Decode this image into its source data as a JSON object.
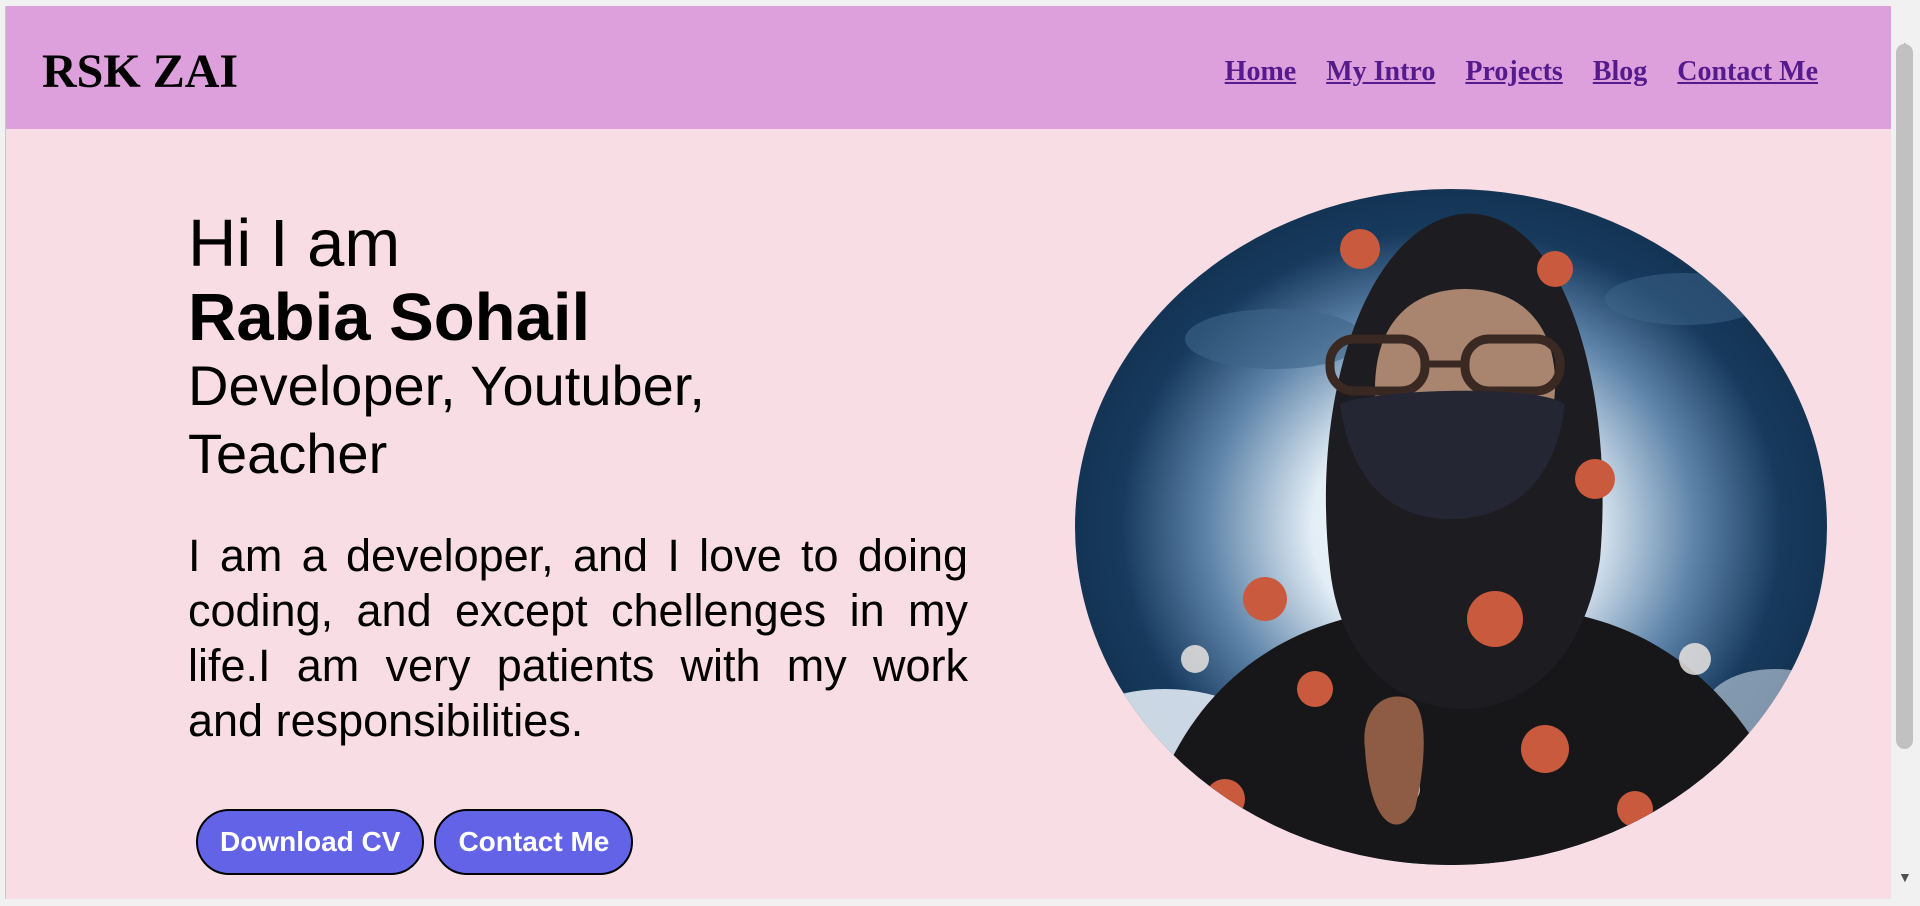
{
  "brand": "RSK ZAI",
  "nav": {
    "items": [
      {
        "label": "Home"
      },
      {
        "label": "My Intro"
      },
      {
        "label": "Projects"
      },
      {
        "label": "Blog"
      },
      {
        "label": "Contact Me"
      }
    ]
  },
  "hero": {
    "greeting": "Hi I am",
    "name": "Rabia Sohail",
    "roles": "Developer, Youtuber, Teacher",
    "about": "I am a developer, and I love to doing coding, and except chellenges in my life.I am very patients with my work and responsibilities.",
    "buttons": {
      "download": "Download CV",
      "contact": "Contact Me"
    }
  },
  "colors": {
    "navbar": "#dda0dd",
    "page": "#f9dde4",
    "link": "#551a8b",
    "button": "#6363e8"
  },
  "icons": {
    "scroll_up": "scroll-up-arrow-icon",
    "scroll_down": "scroll-down-arrow-icon"
  }
}
